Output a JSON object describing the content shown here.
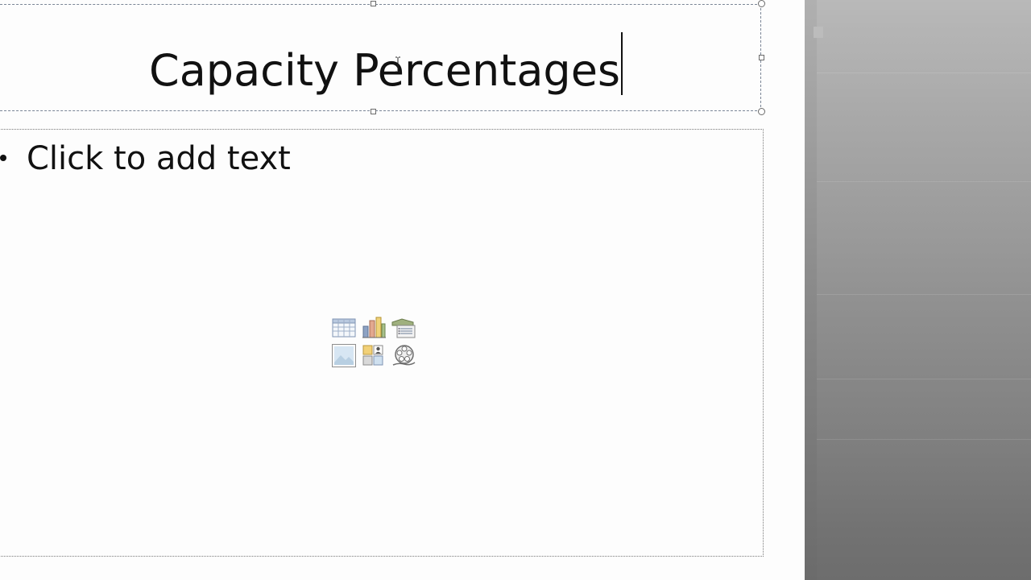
{
  "slide": {
    "title": "Capacity Percentages",
    "body_bullet_text": "Click to add text"
  },
  "insert_icons": [
    {
      "name": "insert-table-icon",
      "label": "Insert Table"
    },
    {
      "name": "insert-chart-icon",
      "label": "Insert Chart"
    },
    {
      "name": "insert-smartart-icon",
      "label": "Insert SmartArt Graphic"
    },
    {
      "name": "insert-picture-icon",
      "label": "Insert Picture from File"
    },
    {
      "name": "insert-clipart-icon",
      "label": "Clip Art"
    },
    {
      "name": "insert-media-icon",
      "label": "Insert Media Clip"
    }
  ],
  "colors": {
    "slide_bg": "#fdfdfd",
    "placeholder_border": "#7a8596",
    "side_pane": "#9a9a9a"
  }
}
